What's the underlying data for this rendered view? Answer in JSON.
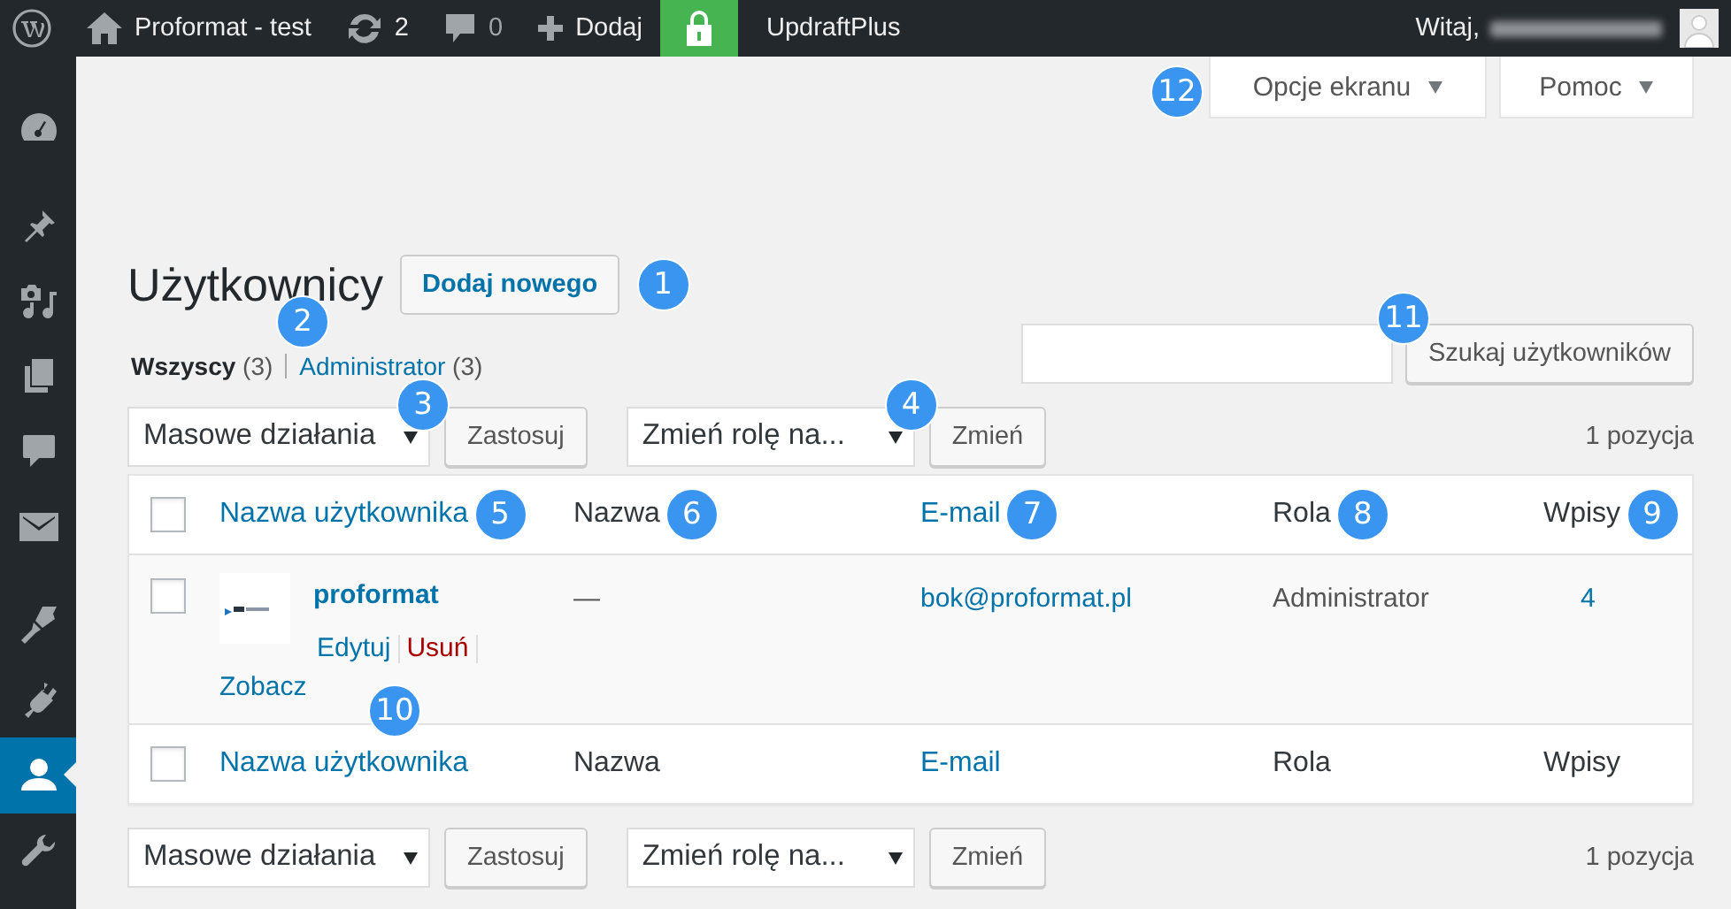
{
  "admin_bar": {
    "site_name": "Proformat - test",
    "updates": "2",
    "comments": "0",
    "new_label": "Dodaj",
    "plugin_label": "UpdraftPlus",
    "greeting": "Witaj,"
  },
  "sidebar": {
    "groups": [
      [
        {
          "kind": "dashboard",
          "selected": false
        }
      ],
      [
        {
          "kind": "pin",
          "selected": false
        },
        {
          "kind": "media",
          "selected": false
        },
        {
          "kind": "pages",
          "selected": false
        },
        {
          "kind": "comments",
          "selected": false
        },
        {
          "kind": "mail",
          "selected": false
        }
      ],
      [
        {
          "kind": "brush",
          "selected": false
        },
        {
          "kind": "plug",
          "selected": false
        },
        {
          "kind": "users",
          "selected": true
        },
        {
          "kind": "wrench",
          "selected": false
        }
      ]
    ]
  },
  "screen_tabs": [
    {
      "label": "Opcje ekranu",
      "callout": "12"
    },
    {
      "label": "Pomoc"
    }
  ],
  "page_title": "Użytkownicy",
  "add_new": {
    "label": "Dodaj nowego",
    "callout": "1"
  },
  "filters": [
    {
      "label": "Wszyscy",
      "count": "(3)",
      "selected": true
    },
    {
      "label": "Administrator",
      "count": "(3)",
      "selected": false
    }
  ],
  "filters_callout": "2",
  "search": {
    "button": "Szukaj użytkowników",
    "callout": "11"
  },
  "tablenav_top": {
    "bulk": "Masowe działania",
    "bulk_callout": "3",
    "apply": "Zastosuj",
    "role": "Zmień rolę na...",
    "role_callout": "4",
    "change": "Zmień",
    "count": "1 pozycja"
  },
  "table": {
    "columns": [
      {
        "label": "Nazwa użytkownika",
        "sortable": true,
        "callout": "5"
      },
      {
        "label": "Nazwa",
        "sortable": false,
        "callout": "6"
      },
      {
        "label": "E-mail",
        "sortable": true,
        "callout": "7"
      },
      {
        "label": "Rola",
        "sortable": false,
        "callout": "8"
      },
      {
        "label": "Wpisy",
        "sortable": false,
        "callout": "9"
      }
    ],
    "footer_columns": [
      {
        "label": "Nazwa użytkownika",
        "sortable": true
      },
      {
        "label": "Nazwa",
        "sortable": false
      },
      {
        "label": "E-mail",
        "sortable": true
      },
      {
        "label": "Rola",
        "sortable": false
      },
      {
        "label": "Wpisy",
        "sortable": false
      }
    ],
    "header_checked": false,
    "footer_checked": false,
    "rows": [
      {
        "checked": false,
        "username": "proformat",
        "name": "—",
        "email": "bok@proformat.pl",
        "role": "Administrator",
        "posts": "4",
        "actions": [
          {
            "label": "Edytuj",
            "kind": "normal"
          },
          {
            "label": "Usuń",
            "kind": "delete"
          },
          {
            "label": "Zobacz",
            "kind": "normal"
          }
        ],
        "actions_callout": "10"
      }
    ]
  },
  "tablenav_bottom": {
    "bulk": "Masowe działania",
    "apply": "Zastosuj",
    "role": "Zmień rolę na...",
    "change": "Zmień",
    "count": "1 pozycja"
  }
}
